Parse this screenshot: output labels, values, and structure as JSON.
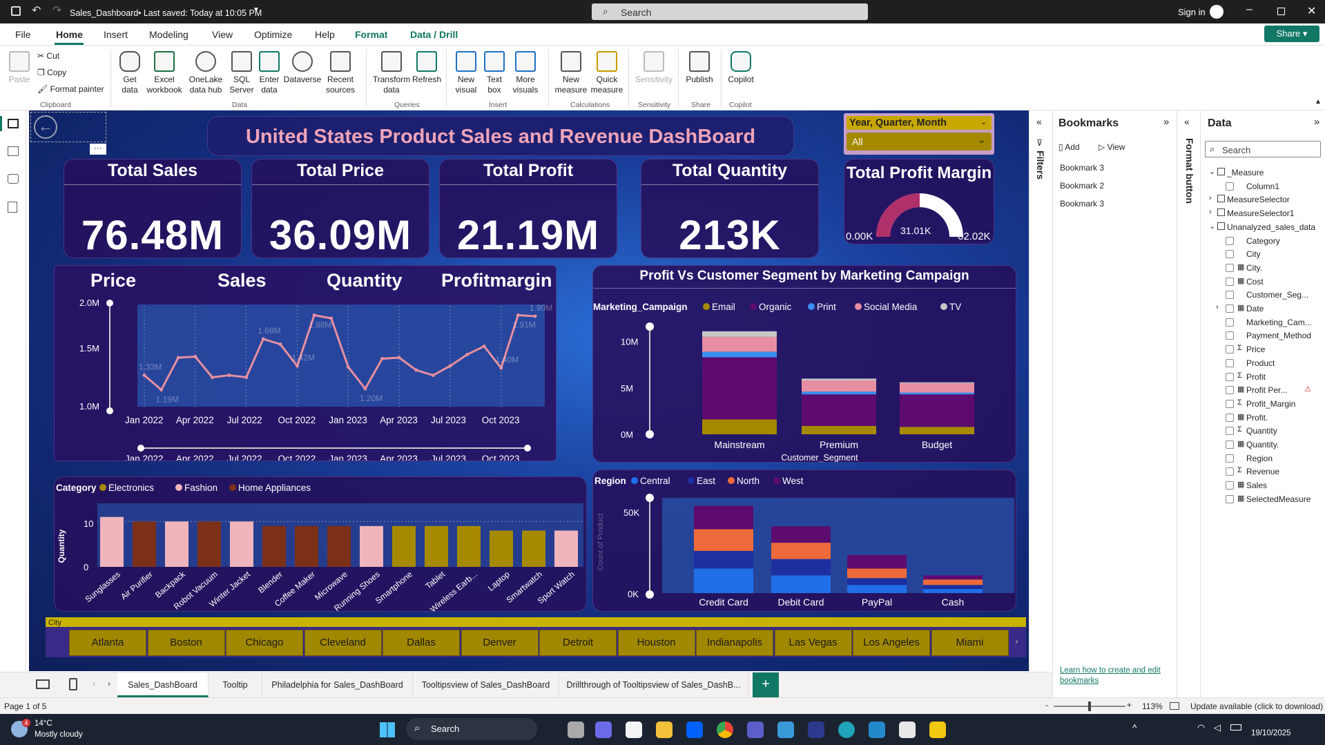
{
  "titlebar": {
    "file_title": "Sales_Dashboard",
    "saved": "• Last saved: Today at 10:05 PM",
    "search_placeholder": "Search",
    "sign_in": "Sign in"
  },
  "menu": [
    "File",
    "Home",
    "Insert",
    "Modeling",
    "View",
    "Optimize",
    "Help",
    "Format",
    "Data / Drill"
  ],
  "share_label": "Share",
  "ribbon": {
    "clipboard": {
      "paste": "Paste",
      "cut": "Cut",
      "copy": "Copy",
      "format_painter": "Format painter",
      "label": "Clipboard"
    },
    "data": {
      "get_data": "Get\ndata",
      "excel": "Excel\nworkbook",
      "onelake": "OneLake\ndata hub",
      "sql": "SQL\nServer",
      "enter": "Enter\ndata",
      "dataverse": "Dataverse",
      "recent": "Recent\nsources",
      "label": "Data"
    },
    "queries": {
      "transform": "Transform\ndata",
      "refresh": "Refresh",
      "label": "Queries"
    },
    "insert": {
      "new_visual": "New\nvisual",
      "text_box": "Text\nbox",
      "more_visuals": "More\nvisuals",
      "label": "Insert"
    },
    "calculations": {
      "new_measure": "New\nmeasure",
      "quick_measure": "Quick\nmeasure",
      "label": "Calculations"
    },
    "sensitivity": {
      "sensitivity": "Sensitivity",
      "label": "Sensitivity"
    },
    "share": {
      "publish": "Publish",
      "label": "Share"
    },
    "copilot": {
      "copilot": "Copilot",
      "label": "Copilot"
    }
  },
  "dashboard": {
    "title": "United States Product Sales and Revenue DashBoard",
    "slicer": {
      "header": "Year, Quarter, Month",
      "value": "All"
    },
    "kpis": [
      {
        "title": "Total Sales",
        "value": "76.48M"
      },
      {
        "title": "Total Price",
        "value": "36.09M"
      },
      {
        "title": "Total Profit",
        "value": "21.19M"
      },
      {
        "title": "Total Quantity",
        "value": "213K"
      }
    ],
    "gauge": {
      "title": "Total Profit Margin",
      "min": "0.00K",
      "value": "31.01K",
      "max": "62.02K"
    },
    "line_tabs": [
      "Price",
      "Sales",
      "Quantity",
      "Profitmargin"
    ]
  },
  "chart_data": [
    {
      "type": "line",
      "title": "",
      "x": [
        "Jan 2022",
        "Feb 2022",
        "Mar 2022",
        "Apr 2022",
        "May 2022",
        "Jun 2022",
        "Jul 2022",
        "Aug 2022",
        "Sep 2022",
        "Oct 2022",
        "Nov 2022",
        "Dec 2022",
        "Jan 2023",
        "Feb 2023",
        "Mar 2023",
        "Apr 2023",
        "May 2023",
        "Jun 2023",
        "Jul 2023",
        "Aug 2023",
        "Sep 2023",
        "Oct 2023",
        "Nov 2023",
        "Dec 2023"
      ],
      "values": [
        1.33,
        1.19,
        1.5,
        1.51,
        1.31,
        1.33,
        1.31,
        1.68,
        1.63,
        1.42,
        1.91,
        1.88,
        1.41,
        1.2,
        1.49,
        1.5,
        1.38,
        1.33,
        1.42,
        1.53,
        1.61,
        1.4,
        1.91,
        1.9
      ],
      "x_tick_labels": [
        "Jan 2022",
        "Apr 2022",
        "Jul 2022",
        "Oct 2022",
        "Jan 2023",
        "Apr 2023",
        "Jul 2023",
        "Oct 2023"
      ],
      "data_labels": [
        "1.33M",
        "1.19M",
        "1.68M",
        "1.88M",
        "1.42M",
        "1.20M",
        "1.40M",
        "1.91M",
        "1.90M"
      ],
      "y_tick_labels": [
        "2.0M",
        "1.5M",
        "1.0M"
      ],
      "ylim": [
        1.0,
        2.0
      ],
      "color": "#e78ea0"
    },
    {
      "type": "bar",
      "title": "Profit Vs Customer Segment by Marketing Campaign",
      "legend_title": "Marketing_Campaign",
      "xlabel": "Customer_Segment",
      "categories": [
        "Mainstream",
        "Premium",
        "Budget"
      ],
      "series": [
        {
          "name": "Email",
          "color": "#a58a00",
          "values": [
            1.6,
            0.9,
            0.8
          ]
        },
        {
          "name": "Organic",
          "color": "#5d0b6e",
          "values": [
            6.7,
            3.4,
            3.5
          ]
        },
        {
          "name": "Print",
          "color": "#3b8ff0",
          "values": [
            0.6,
            0.3,
            0.2
          ]
        },
        {
          "name": "Social Media",
          "color": "#e88ea2",
          "values": [
            1.6,
            1.2,
            1.0
          ]
        },
        {
          "name": "TV",
          "color": "#c8c8c8",
          "values": [
            0.6,
            0.2,
            0.1
          ]
        }
      ],
      "y_tick_labels": [
        "10M",
        "5M",
        "0M"
      ],
      "ylim": [
        0,
        12.5
      ],
      "stacked": true
    },
    {
      "type": "bar",
      "title": "",
      "legend_title": "Category",
      "ylabel": "Quantity",
      "categories": [
        "Sunglasses",
        "Air Purifier",
        "Backpack",
        "Robot Vacuum",
        "Winter Jacket",
        "Blender",
        "Coffee Maker",
        "Microwave",
        "Running Shoes",
        "Smartphone",
        "Tablet",
        "Wireless Earb...",
        "Laptop",
        "Smartwatch",
        "Sport Watch"
      ],
      "values": [
        11,
        10,
        10,
        10,
        10,
        9,
        9,
        9,
        9,
        9,
        9,
        9,
        8,
        8,
        8
      ],
      "series": [
        {
          "name": "Electronics",
          "color": "#a58a00"
        },
        {
          "name": "Fashion",
          "color": "#f0b4bc"
        },
        {
          "name": "Home Appliances",
          "color": "#7d3018"
        }
      ],
      "bar_category": [
        "Fashion",
        "Home Appliances",
        "Fashion",
        "Home Appliances",
        "Fashion",
        "Home Appliances",
        "Home Appliances",
        "Home Appliances",
        "Fashion",
        "Electronics",
        "Electronics",
        "Electronics",
        "Electronics",
        "Electronics",
        "Fashion"
      ],
      "y_tick_labels": [
        "10",
        "0"
      ],
      "ylim": [
        0,
        14
      ]
    },
    {
      "type": "bar",
      "title": "",
      "legend_title": "Region",
      "ylabel": "Count of Product",
      "categories": [
        "Credit Card",
        "Debit Card",
        "PayPal",
        "Cash"
      ],
      "series": [
        {
          "name": "Central",
          "color": "#1f6fe8",
          "values": [
            18,
            13,
            6,
            3
          ]
        },
        {
          "name": "East",
          "color": "#1e2fa0",
          "values": [
            13,
            12,
            5,
            3
          ]
        },
        {
          "name": "North",
          "color": "#ee6a3a",
          "values": [
            16,
            12,
            7,
            4
          ]
        },
        {
          "name": "West",
          "color": "#5d0b6e",
          "values": [
            17,
            12,
            10,
            3
          ]
        }
      ],
      "y_tick_labels": [
        "50K",
        "0K"
      ],
      "ylim": [
        0,
        70
      ],
      "stacked": true
    }
  ],
  "city_slicer": {
    "header": "City",
    "items": [
      "Atlanta",
      "Boston",
      "Chicago",
      "Cleveland",
      "Dallas",
      "Denver",
      "Detroit",
      "Houston",
      "Indianapolis",
      "Las Vegas",
      "Los Angeles",
      "Miami"
    ]
  },
  "filters_label": "Filters",
  "format_button_label": "Format button",
  "bookmarks": {
    "title": "Bookmarks",
    "add": "Add",
    "view": "View",
    "items": [
      "Bookmark 3",
      "Bookmark 2",
      "Bookmark 3"
    ],
    "help_link": "Learn how to create and edit bookmarks"
  },
  "data_panel": {
    "title": "Data",
    "search_placeholder": "Search",
    "fields": [
      {
        "label": "_Measure",
        "level": 0,
        "kind": "table"
      },
      {
        "label": "Column1",
        "level": 1,
        "kind": "field"
      },
      {
        "label": "MeasureSelector",
        "level": 0,
        "kind": "table"
      },
      {
        "label": "MeasureSelector1",
        "level": 0,
        "kind": "table"
      },
      {
        "label": "Unanalyzed_sales_data",
        "level": 0,
        "kind": "table"
      },
      {
        "label": "Category",
        "level": 1,
        "kind": "field"
      },
      {
        "label": "City",
        "level": 1,
        "kind": "field"
      },
      {
        "label": "City.",
        "level": 1,
        "kind": "calc"
      },
      {
        "label": "Cost",
        "level": 1,
        "kind": "calc"
      },
      {
        "label": "Customer_Seg...",
        "level": 1,
        "kind": "field"
      },
      {
        "label": "Date",
        "level": 1,
        "kind": "calc"
      },
      {
        "label": "Marketing_Cam...",
        "level": 1,
        "kind": "field"
      },
      {
        "label": "Payment_Method",
        "level": 1,
        "kind": "field"
      },
      {
        "label": "Price",
        "level": 1,
        "kind": "sum"
      },
      {
        "label": "Product",
        "level": 1,
        "kind": "field"
      },
      {
        "label": "Profit",
        "level": 1,
        "kind": "sum"
      },
      {
        "label": "Profit Per...",
        "level": 1,
        "kind": "calc"
      },
      {
        "label": "Profit_Margin",
        "level": 1,
        "kind": "sum"
      },
      {
        "label": "Profit.",
        "level": 1,
        "kind": "calc"
      },
      {
        "label": "Quantity",
        "level": 1,
        "kind": "sum"
      },
      {
        "label": "Quantity.",
        "level": 1,
        "kind": "calc"
      },
      {
        "label": "Region",
        "level": 1,
        "kind": "field"
      },
      {
        "label": "Revenue",
        "level": 1,
        "kind": "sum"
      },
      {
        "label": "Sales",
        "level": 1,
        "kind": "calc"
      },
      {
        "label": "SelectedMeasure",
        "level": 1,
        "kind": "calc"
      }
    ]
  },
  "page_tabs": [
    "Sales_DashBoard",
    "Tooltip",
    "Philadelphia for Sales_DashBoard",
    "Tooltipsview of Sales_DashBoard",
    "Drillthrough of Tooltipsview of Sales_DashB..."
  ],
  "status": {
    "page": "Page 1 of 5",
    "zoom": "113%",
    "update": "Update available (click to download)"
  },
  "taskbar": {
    "temp": "14°C",
    "weather": "Mostly cloudy",
    "search": "Search",
    "date": "19/10/2025",
    "weather_badge": "4"
  }
}
